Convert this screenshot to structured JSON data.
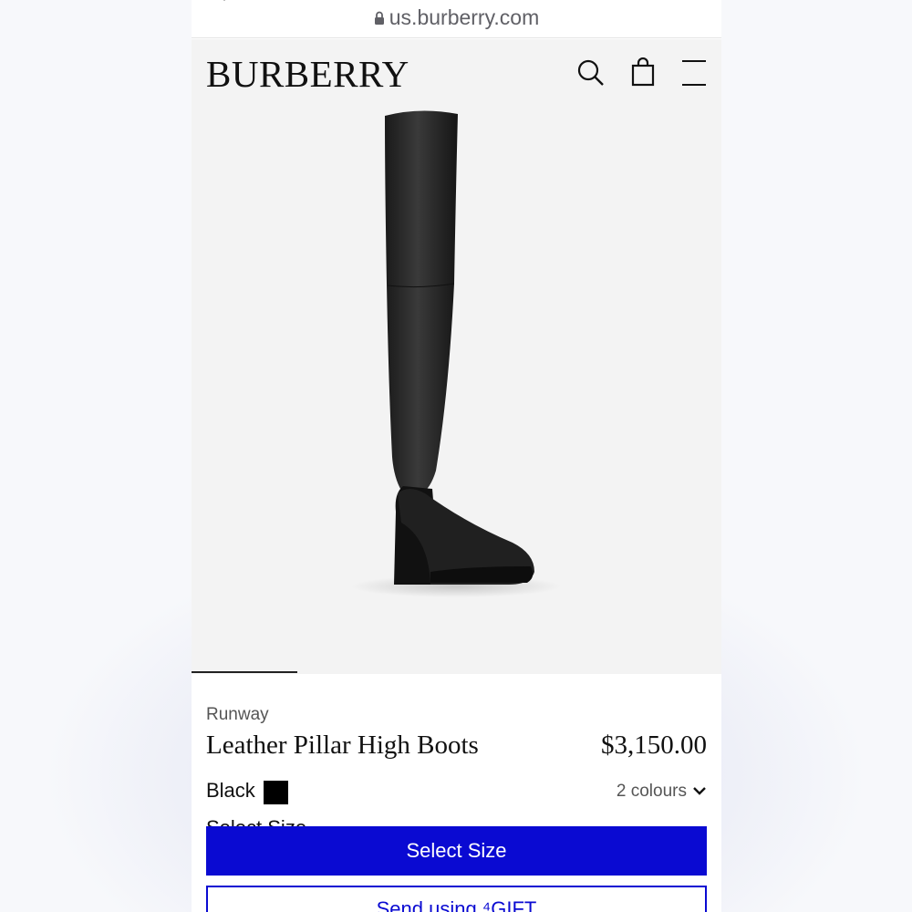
{
  "browser": {
    "url": "us.burberry.com"
  },
  "header": {
    "logo": "BURBERRY",
    "icons": [
      "search-icon",
      "shopping-bag-icon",
      "menu-icon"
    ]
  },
  "gallery": {
    "progress_fraction": 0.2,
    "image": "black over-the-knee wedge boot"
  },
  "product": {
    "collection": "Runway",
    "name": "Leather Pillar High Boots",
    "price": "$3,150.00",
    "colour_name": "Black",
    "colour_swatch": "#000000",
    "colours_count": "2 colours",
    "size_label_partial": "Select Size"
  },
  "actions": {
    "select_size": "Select Size",
    "send_gift": "Send using ⁴GIFT"
  },
  "colors": {
    "accent": "#0a0ad2",
    "header_bg": "#f3f3f3"
  }
}
